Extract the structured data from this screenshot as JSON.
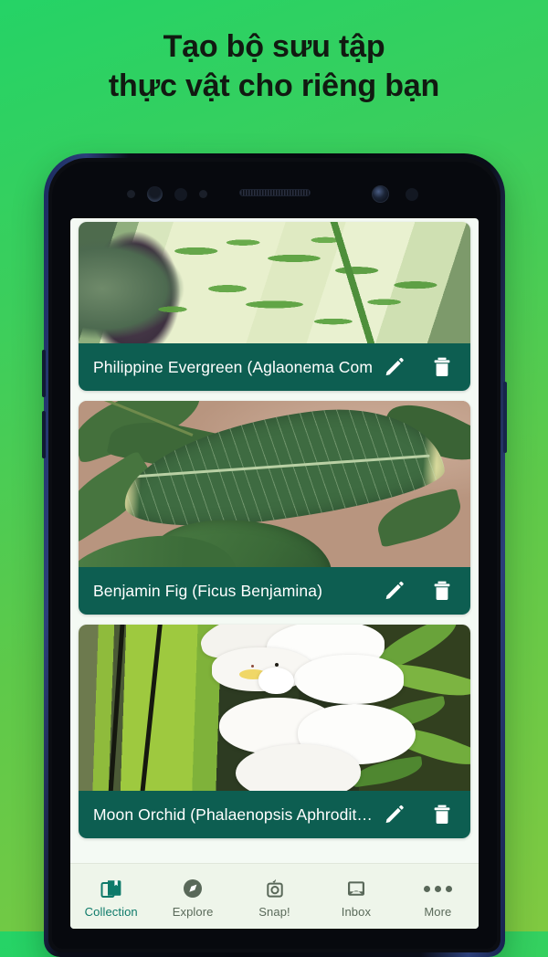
{
  "headline": {
    "line1": "Tạo bộ sưu tập",
    "line2": "thực vật cho riêng bạn"
  },
  "colors": {
    "background_start": "#25d366",
    "background_end": "#80c941",
    "label_bar": "#0d5e51",
    "screen_bg": "#f4faf4",
    "nav_bg": "#eef5ea",
    "nav_active": "#0e7a6a",
    "nav_inactive": "#5a6a5a"
  },
  "collection": {
    "cards": [
      {
        "title": "Philippine Evergreen (Aglaonema Com…",
        "photo": "aglaonema-variegated-leaf-photo",
        "edit_icon": "pencil-icon",
        "delete_icon": "trash-icon"
      },
      {
        "title": "Benjamin Fig (Ficus Benjamina)",
        "photo": "ficus-variegated-leaf-photo",
        "edit_icon": "pencil-icon",
        "delete_icon": "trash-icon"
      },
      {
        "title": "Moon Orchid  (Phalaenopsis Aphrodit…",
        "photo": "white-orchid-bloom-photo",
        "edit_icon": "pencil-icon",
        "delete_icon": "trash-icon"
      }
    ]
  },
  "navbar": {
    "items": [
      {
        "label": "Collection",
        "icon": "collection-books-icon",
        "active": true
      },
      {
        "label": "Explore",
        "icon": "compass-icon",
        "active": false
      },
      {
        "label": "Snap!",
        "icon": "camera-leaf-icon",
        "active": false
      },
      {
        "label": "Inbox",
        "icon": "inbox-tray-icon",
        "active": false
      },
      {
        "label": "More",
        "icon": "more-dots-icon",
        "active": false
      }
    ]
  },
  "device": {
    "front_camera": "front-camera-icon",
    "earpiece": "earpiece-speaker",
    "sensors": "proximity-sensors"
  }
}
